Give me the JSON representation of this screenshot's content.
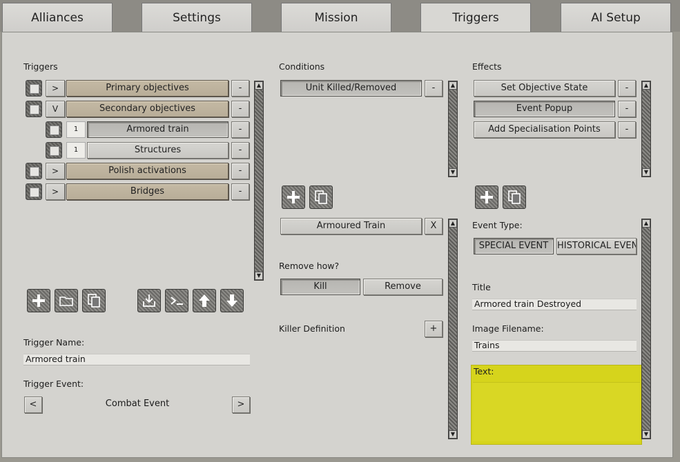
{
  "tabs": [
    {
      "label": "Alliances"
    },
    {
      "label": "Settings"
    },
    {
      "label": "Mission"
    },
    {
      "label": "Triggers"
    },
    {
      "label": "AI Setup"
    }
  ],
  "triggers": {
    "heading": "Triggers",
    "items": [
      {
        "expander": ">",
        "label": "Primary objectives",
        "remove": "-"
      },
      {
        "expander": "V",
        "label": "Secondary objectives",
        "remove": "-"
      },
      {
        "number": "1",
        "label": "Armored train",
        "remove": "-"
      },
      {
        "number": "1",
        "label": "Structures",
        "remove": "-"
      },
      {
        "expander": ">",
        "label": "Polish activations",
        "remove": "-"
      },
      {
        "expander": ">",
        "label": "Bridges",
        "remove": "-"
      }
    ],
    "name_label": "Trigger Name:",
    "name_value": "Armored train",
    "event_label": "Trigger Event:",
    "event_prev": "<",
    "event_value": "Combat Event",
    "event_next": ">"
  },
  "conditions": {
    "heading": "Conditions",
    "items": [
      {
        "label": "Unit Killed/Removed",
        "remove": "-"
      }
    ],
    "selected_unit": "Armoured Train",
    "selected_unit_remove": "X",
    "remove_how_label": "Remove how?",
    "remove_how_options": [
      "Kill",
      "Remove"
    ],
    "killer_label": "Killer Definition",
    "killer_add": "+"
  },
  "effects": {
    "heading": "Effects",
    "items": [
      {
        "label": "Set Objective State",
        "remove": "-"
      },
      {
        "label": "Event Popup",
        "remove": "-"
      },
      {
        "label": "Add Specialisation Points",
        "remove": "-"
      }
    ],
    "event_type_label": "Event Type:",
    "event_type_options": [
      "SPECIAL EVENT",
      "HISTORICAL EVENT"
    ],
    "title_label": "Title",
    "title_value": "Armored train Destroyed",
    "image_label": "Image Filename:",
    "image_value": "Trains",
    "text_label": "Text:"
  },
  "colors": {
    "highlight": "#d6d41c",
    "tan_button": "#c0b5a0"
  }
}
